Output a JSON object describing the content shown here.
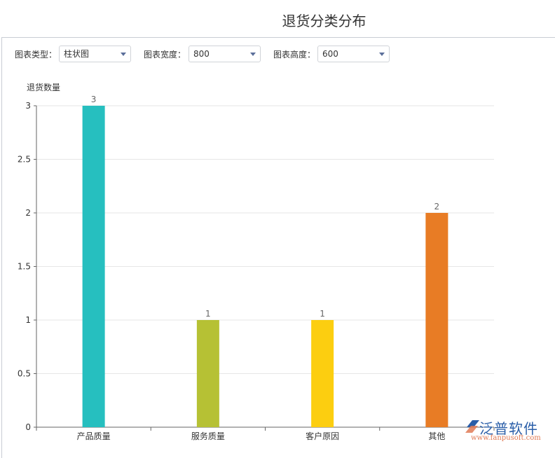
{
  "page": {
    "title": "退货分类分布"
  },
  "controls": [
    {
      "label": "图表类型：",
      "value": "柱状图"
    },
    {
      "label": "图表宽度：",
      "value": "800"
    },
    {
      "label": "图表高度：",
      "value": "600"
    }
  ],
  "logo": {
    "name": "泛普软件",
    "url": "www.fanpusoft.com"
  },
  "chart_data": {
    "type": "bar",
    "title": "退货分类分布",
    "xlabel": "",
    "ylabel": "退货数量",
    "categories": [
      "产品质量",
      "服务质量",
      "客户原因",
      "其他"
    ],
    "values": [
      3,
      1,
      1,
      2
    ],
    "colors": [
      "#26bfbf",
      "#b6c134",
      "#fcce10",
      "#e87c25"
    ],
    "ylim": [
      0,
      3
    ],
    "yticks": [
      "0",
      "0.5",
      "1",
      "1.5",
      "2",
      "2.5",
      "3"
    ],
    "grid": true,
    "data_labels": [
      "3",
      "1",
      "1",
      "2"
    ]
  }
}
